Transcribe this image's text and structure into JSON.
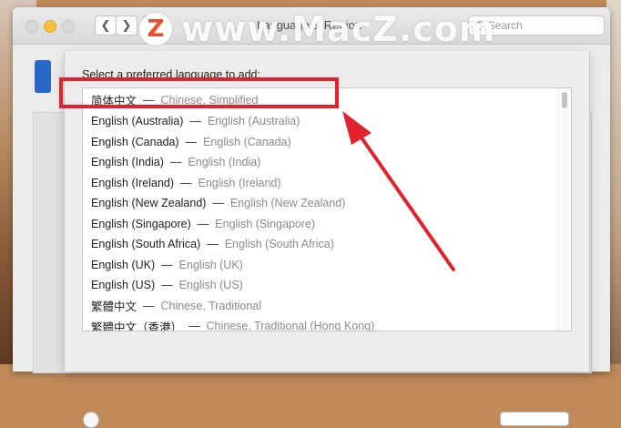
{
  "window": {
    "title": "Language & Region",
    "search_placeholder": "Search"
  },
  "sheet": {
    "prompt": "Select a preferred language to add:",
    "languages": [
      {
        "native": "简体中文",
        "english": "Chinese, Simplified"
      },
      {
        "native": "English (Australia)",
        "english": "English (Australia)"
      },
      {
        "native": "English (Canada)",
        "english": "English (Canada)"
      },
      {
        "native": "English (India)",
        "english": "English (India)"
      },
      {
        "native": "English (Ireland)",
        "english": "English (Ireland)"
      },
      {
        "native": "English (New Zealand)",
        "english": "English (New Zealand)"
      },
      {
        "native": "English (Singapore)",
        "english": "English (Singapore)"
      },
      {
        "native": "English (South Africa)",
        "english": "English (South Africa)"
      },
      {
        "native": "English (UK)",
        "english": "English (UK)"
      },
      {
        "native": "English (US)",
        "english": "English (US)"
      },
      {
        "native": "繁體中文",
        "english": "Chinese, Traditional"
      },
      {
        "native": "繁體中文（香港）",
        "english": "Chinese, Traditional (Hong Kong)"
      }
    ],
    "separator": "—"
  },
  "annotation": {
    "color": "#e2222c"
  },
  "watermark": {
    "logo_letter": "Z",
    "text": "www.MacZ.com"
  },
  "icons": {
    "back": "chevron-left-icon",
    "forward": "chevron-right-icon",
    "grid": "grid-icon",
    "search": "search-icon"
  }
}
